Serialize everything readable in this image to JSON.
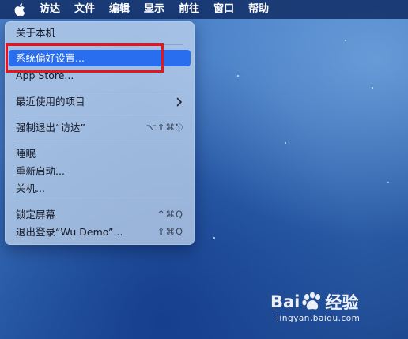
{
  "menubar": {
    "apple_icon": "apple-logo-icon",
    "app_name": "访达",
    "items": [
      "文件",
      "编辑",
      "显示",
      "前往",
      "窗口",
      "帮助"
    ]
  },
  "apple_menu": {
    "items": [
      {
        "label": "关于本机",
        "shortcut": ""
      },
      {
        "label": "系统偏好设置...",
        "shortcut": "",
        "selected": true
      },
      {
        "label": "App Store...",
        "shortcut": ""
      },
      {
        "label": "最近使用的项目",
        "shortcut": "",
        "submenu_icon": "chevron-right-icon"
      },
      {
        "label": "强制退出“访达”",
        "shortcut": "⌥⇧⌘⎋"
      },
      {
        "label": "睡眠",
        "shortcut": ""
      },
      {
        "label": "重新启动...",
        "shortcut": ""
      },
      {
        "label": "关机...",
        "shortcut": ""
      },
      {
        "label": "锁定屏幕",
        "shortcut": "^⌘Q"
      },
      {
        "label": "退出登录“Wu Demo”...",
        "shortcut": "⇧⌘Q"
      }
    ]
  },
  "annotation": {
    "color": "#e8141a"
  },
  "colors": {
    "selection": "#2a6ef0",
    "menubar": "#16346e"
  },
  "watermark": {
    "brand_left": "Bai",
    "brand_right": "经验",
    "url": "jingyan.baidu.com"
  }
}
